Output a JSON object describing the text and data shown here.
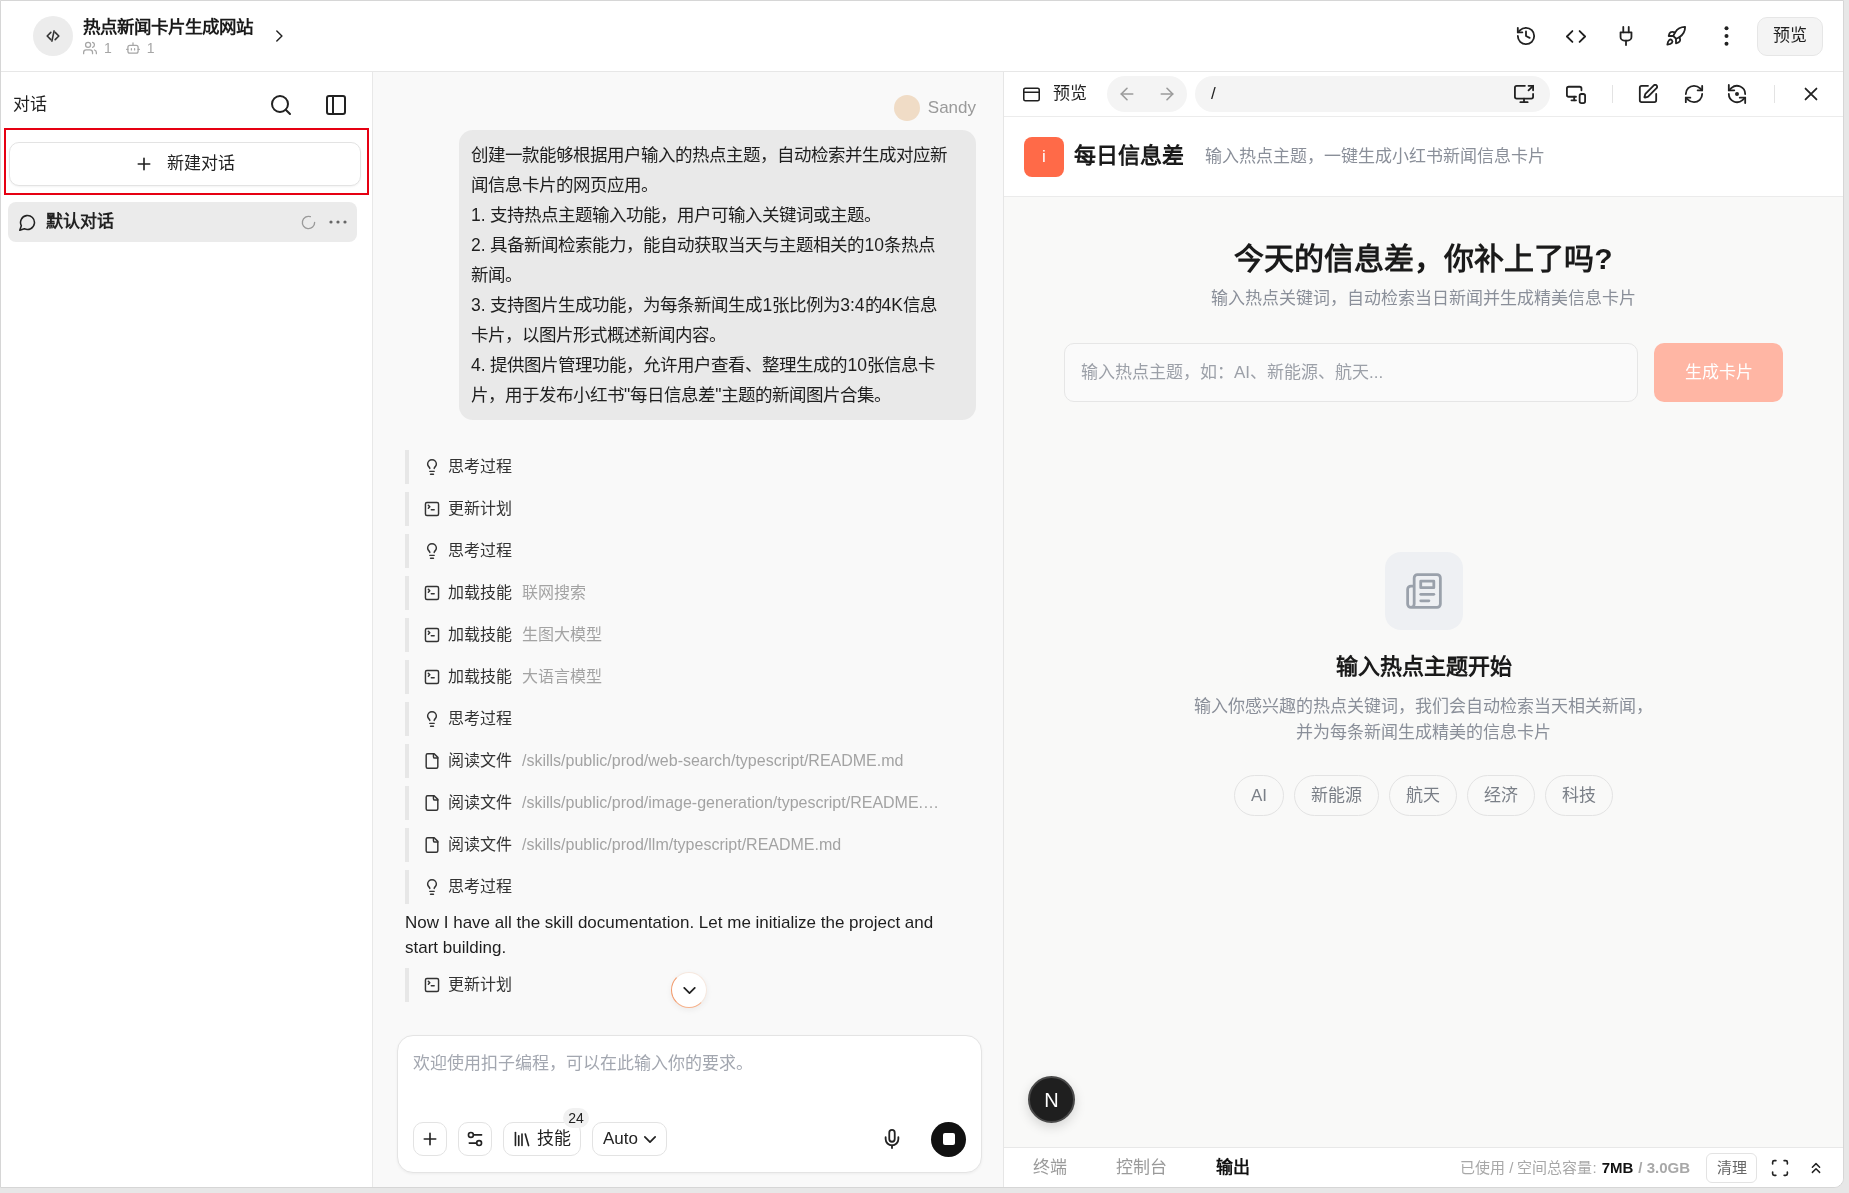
{
  "header": {
    "project_title": "热点新闻卡片生成网站",
    "member_count": "1",
    "bot_count": "1",
    "preview_button": "预览"
  },
  "sidebar": {
    "title": "对话",
    "new_chat": {
      "label": "新建对话",
      "highlighted": true
    },
    "conversations": [
      {
        "title": "默认对话",
        "selected": true,
        "loading": true
      }
    ]
  },
  "chat": {
    "user_name": "Sandy",
    "user_message": "创建一款能够根据用户输入的热点主题，自动检索并生成对应新闻信息卡片的网页应用。\n1. 支持热点主题输入功能，用户可输入关键词或主题。\n2. 具备新闻检索能力，能自动获取当天与主题相关的10条热点新闻。\n3. 支持图片生成功能，为每条新闻生成1张比例为3:4的4K信息卡片，以图片形式概述新闻内容。\n4. 提供图片管理功能，允许用户查看、整理生成的10张信息卡片，用于发布小红书\"每日信息差\"主题的新闻图片合集。",
    "transcript": [
      {
        "kind": "thinking",
        "label": "思考过程"
      },
      {
        "kind": "plan",
        "label": "更新计划"
      },
      {
        "kind": "thinking",
        "label": "思考过程"
      },
      {
        "kind": "skill",
        "label": "加载技能",
        "detail": "联网搜索"
      },
      {
        "kind": "skill",
        "label": "加载技能",
        "detail": "生图大模型"
      },
      {
        "kind": "skill",
        "label": "加载技能",
        "detail": "大语言模型"
      },
      {
        "kind": "thinking",
        "label": "思考过程"
      },
      {
        "kind": "file",
        "label": "阅读文件",
        "detail": "/skills/public/prod/web-search/typescript/README.md"
      },
      {
        "kind": "file",
        "label": "阅读文件",
        "detail": "/skills/public/prod/image-generation/typescript/README.…"
      },
      {
        "kind": "file",
        "label": "阅读文件",
        "detail": "/skills/public/prod/llm/typescript/README.md"
      },
      {
        "kind": "thinking",
        "label": "思考过程"
      },
      {
        "kind": "text",
        "text": "Now I have all the skill documentation. Let me initialize the project and start building."
      },
      {
        "kind": "plan",
        "label": "更新计划"
      }
    ]
  },
  "composer": {
    "placeholder": "欢迎使用扣子编程，可以在此输入你的要求。",
    "skills_label": "技能",
    "skills_count": "24",
    "model": "Auto",
    "generating": true
  },
  "preview": {
    "title": "预览",
    "url": "/",
    "app": {
      "logo": "i",
      "name": "每日信息差",
      "tagline": "输入热点主题，一键生成小红书新闻信息卡片",
      "hero_title": "今天的信息差，你补上了吗?",
      "hero_subtitle": "输入热点关键词，自动检索当日新闻并生成精美信息卡片",
      "topic_input": {
        "placeholder": "输入热点主题，如：AI、新能源、航天..."
      },
      "generate_button": {
        "label": "生成卡片",
        "disabled": true
      },
      "empty_state": {
        "title": "输入热点主题开始",
        "description": "输入你感兴趣的热点关键词，我们会自动检索当天相关新闻，并为每条新闻生成精美的信息卡片"
      },
      "topic_chips": [
        "AI",
        "新能源",
        "航天",
        "经济",
        "科技"
      ]
    },
    "dev_indicator": "N"
  },
  "bottom_panel": {
    "tabs": [
      {
        "label": "终端",
        "selected": false
      },
      {
        "label": "控制台",
        "selected": false
      },
      {
        "label": "输出",
        "selected": true
      }
    ],
    "storage_label": "已使用 / 空间总容量:",
    "storage_used": "7MB",
    "storage_total": "/ 3.0GB",
    "clear_button": "清理"
  }
}
